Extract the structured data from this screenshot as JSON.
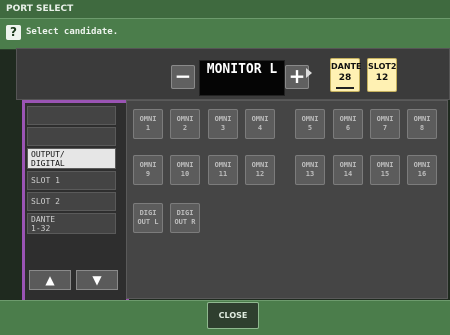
{
  "window": {
    "title": "PORT SELECT"
  },
  "prompt": {
    "help_icon": "?",
    "text": "Select candidate."
  },
  "header": {
    "decrement_label": "−",
    "increment_label": "+",
    "port_name": "MONITOR L",
    "chips": [
      {
        "line1": "DANTE",
        "line2": "28"
      },
      {
        "line1": "SLOT2",
        "line2": "12"
      }
    ]
  },
  "categories": {
    "items": [
      {
        "label": "",
        "selected": false
      },
      {
        "label": "",
        "selected": false
      },
      {
        "label": "OUTPUT/\nDIGITAL",
        "selected": true
      },
      {
        "label": "SLOT 1",
        "selected": false
      },
      {
        "label": "SLOT 2",
        "selected": false
      },
      {
        "label": "DANTE\n1-32",
        "selected": false
      }
    ],
    "up_label": "▲",
    "down_label": "▼"
  },
  "ports": [
    {
      "l1": "OMNI",
      "l2": "1"
    },
    {
      "l1": "OMNI",
      "l2": "2"
    },
    {
      "l1": "OMNI",
      "l2": "3"
    },
    {
      "l1": "OMNI",
      "l2": "4"
    },
    {
      "l1": "OMNI",
      "l2": "5"
    },
    {
      "l1": "OMNI",
      "l2": "6"
    },
    {
      "l1": "OMNI",
      "l2": "7"
    },
    {
      "l1": "OMNI",
      "l2": "8"
    },
    {
      "l1": "OMNI",
      "l2": "9"
    },
    {
      "l1": "OMNI",
      "l2": "10"
    },
    {
      "l1": "OMNI",
      "l2": "11"
    },
    {
      "l1": "OMNI",
      "l2": "12"
    },
    {
      "l1": "OMNI",
      "l2": "13"
    },
    {
      "l1": "OMNI",
      "l2": "14"
    },
    {
      "l1": "OMNI",
      "l2": "15"
    },
    {
      "l1": "OMNI",
      "l2": "16"
    },
    {
      "l1": "DIGI",
      "l2": "OUT L"
    },
    {
      "l1": "DIGI",
      "l2": "OUT R"
    }
  ],
  "footer": {
    "close_label": "CLOSE"
  }
}
